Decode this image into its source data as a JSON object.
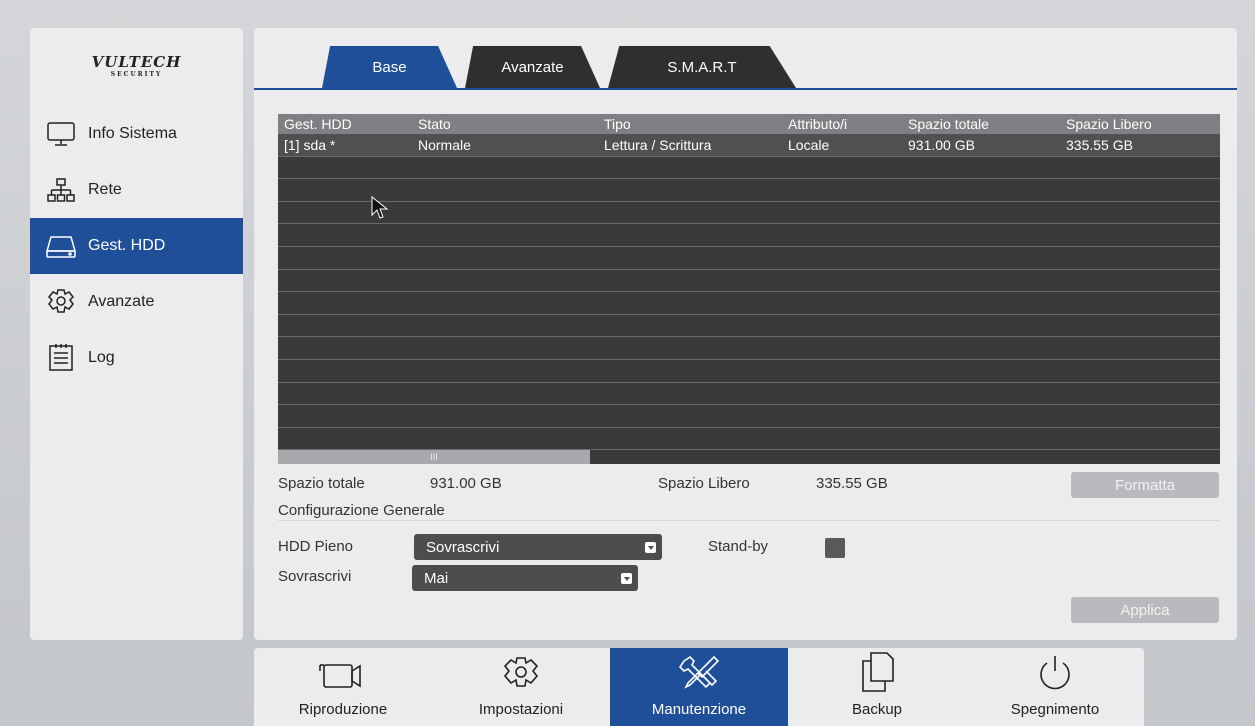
{
  "brand": {
    "logo": "VULTECH",
    "logo_sub": "SECURITY"
  },
  "sidebar": {
    "items": [
      {
        "label": "Info Sistema",
        "icon": "monitor-icon",
        "active": false
      },
      {
        "label": "Rete",
        "icon": "network-icon",
        "active": false
      },
      {
        "label": "Gest. HDD",
        "icon": "hdd-icon",
        "active": true
      },
      {
        "label": "Avanzate",
        "icon": "gear-icon",
        "active": false
      },
      {
        "label": "Log",
        "icon": "log-icon",
        "active": false
      }
    ]
  },
  "tabs": [
    {
      "label": "Base",
      "active": true
    },
    {
      "label": "Avanzate",
      "active": false
    },
    {
      "label": "S.M.A.R.T",
      "active": false
    }
  ],
  "table": {
    "columns": [
      "Gest. HDD",
      "Stato",
      "Tipo",
      "Attributo/i",
      "Spazio totale",
      "Spazio Libero"
    ],
    "rows": [
      [
        "[1] sda *",
        "Normale",
        "Lettura / Scrittura",
        "Locale",
        "931.00 GB",
        "335.55 GB"
      ]
    ],
    "scroll_glyph": "III"
  },
  "summary": {
    "total_label": "Spazio totale",
    "total_value": "931.00 GB",
    "free_label": "Spazio Libero",
    "free_value": "335.55 GB",
    "format_button": "Formatta"
  },
  "config": {
    "title": "Configurazione Generale",
    "hdd_full_label": "HDD Pieno",
    "hdd_full_value": "Sovrascrivi",
    "standby_label": "Stand-by",
    "overwrite_label": "Sovrascrivi",
    "overwrite_value": "Mai",
    "apply_button": "Applica"
  },
  "bottombar": {
    "items": [
      {
        "label": "Riproduzione",
        "icon": "camera-icon",
        "active": false
      },
      {
        "label": "Impostazioni",
        "icon": "gear-icon",
        "active": false
      },
      {
        "label": "Manutenzione",
        "icon": "tools-icon",
        "active": true
      },
      {
        "label": "Backup",
        "icon": "copy-icon",
        "active": false
      },
      {
        "label": "Spegnimento",
        "icon": "power-icon",
        "active": false
      }
    ]
  },
  "colors": {
    "accent": "#1f4f98",
    "table_bg": "#3a3a3c",
    "panel_bg": "#ececec"
  }
}
